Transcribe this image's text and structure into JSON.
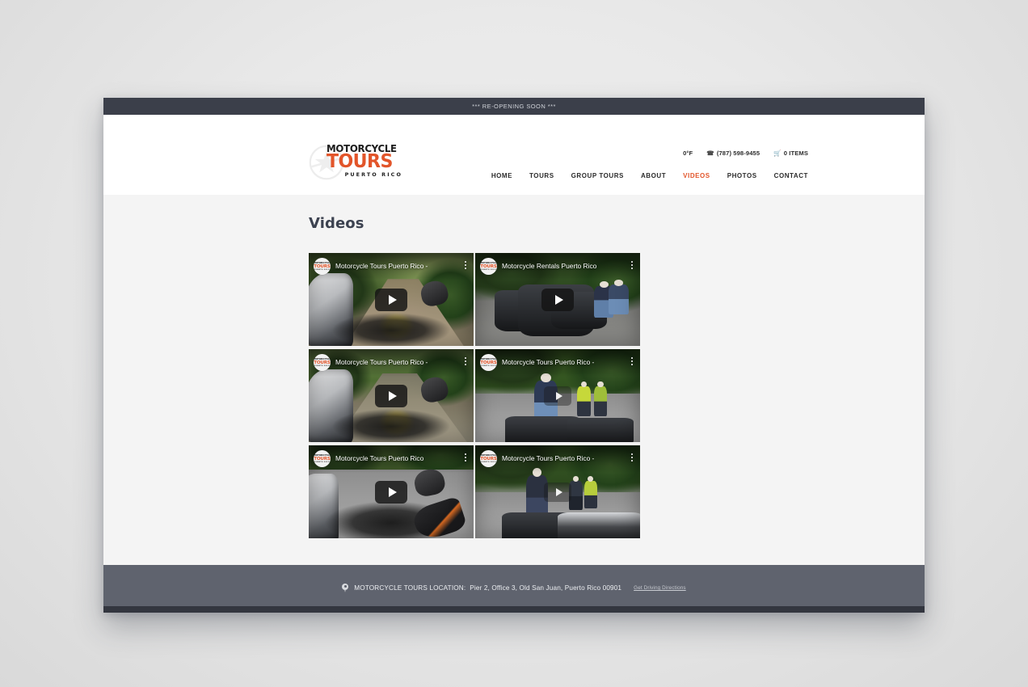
{
  "announcement": {
    "text": "*** RE-OPENING SOON ***"
  },
  "header": {
    "logo": {
      "line1": "MOTORCYCLE",
      "line2": "TOURS",
      "line3": "PUERTO RICO",
      "accent_color": "#e2552a"
    },
    "topinfo": {
      "temperature": "0°F",
      "phone_icon": "phone-icon",
      "phone": "(787) 598-9455",
      "cart_icon": "cart-icon",
      "cart": "0 ITEMS"
    },
    "nav": [
      {
        "label": "HOME",
        "active": false
      },
      {
        "label": "TOURS",
        "active": false
      },
      {
        "label": "GROUP TOURS",
        "active": false
      },
      {
        "label": "ABOUT",
        "active": false
      },
      {
        "label": "VIDEOS",
        "active": true
      },
      {
        "label": "PHOTOS",
        "active": false
      },
      {
        "label": "CONTACT",
        "active": false
      }
    ]
  },
  "main": {
    "title": "Videos",
    "videos": [
      {
        "title": "Motorcycle Tours Puerto Rico -",
        "play_style": "solid",
        "scene": "dirt-trail"
      },
      {
        "title": "Motorcycle Rentals Puerto Rico",
        "play_style": "solid",
        "scene": "bikes-parked"
      },
      {
        "title": "Motorcycle Tours Puerto Rico -",
        "play_style": "solid",
        "scene": "muddy-road"
      },
      {
        "title": "Motorcycle Tours Puerto Rico -",
        "play_style": "ghost",
        "scene": "rider-standing"
      },
      {
        "title": "Motorcycle Tours Puerto Rico",
        "play_style": "solid",
        "scene": "curvy-road"
      },
      {
        "title": "Motorcycle Tours Puerto Rico -",
        "play_style": "ghost",
        "scene": "roadside-group"
      }
    ]
  },
  "footer": {
    "pin_icon": "location-pin-icon",
    "label": "MOTORCYCLE TOURS LOCATION:",
    "address": "Pier 2, Office 3, Old San Juan, Puerto Rico 00901",
    "link": "Get Driving Directions"
  }
}
